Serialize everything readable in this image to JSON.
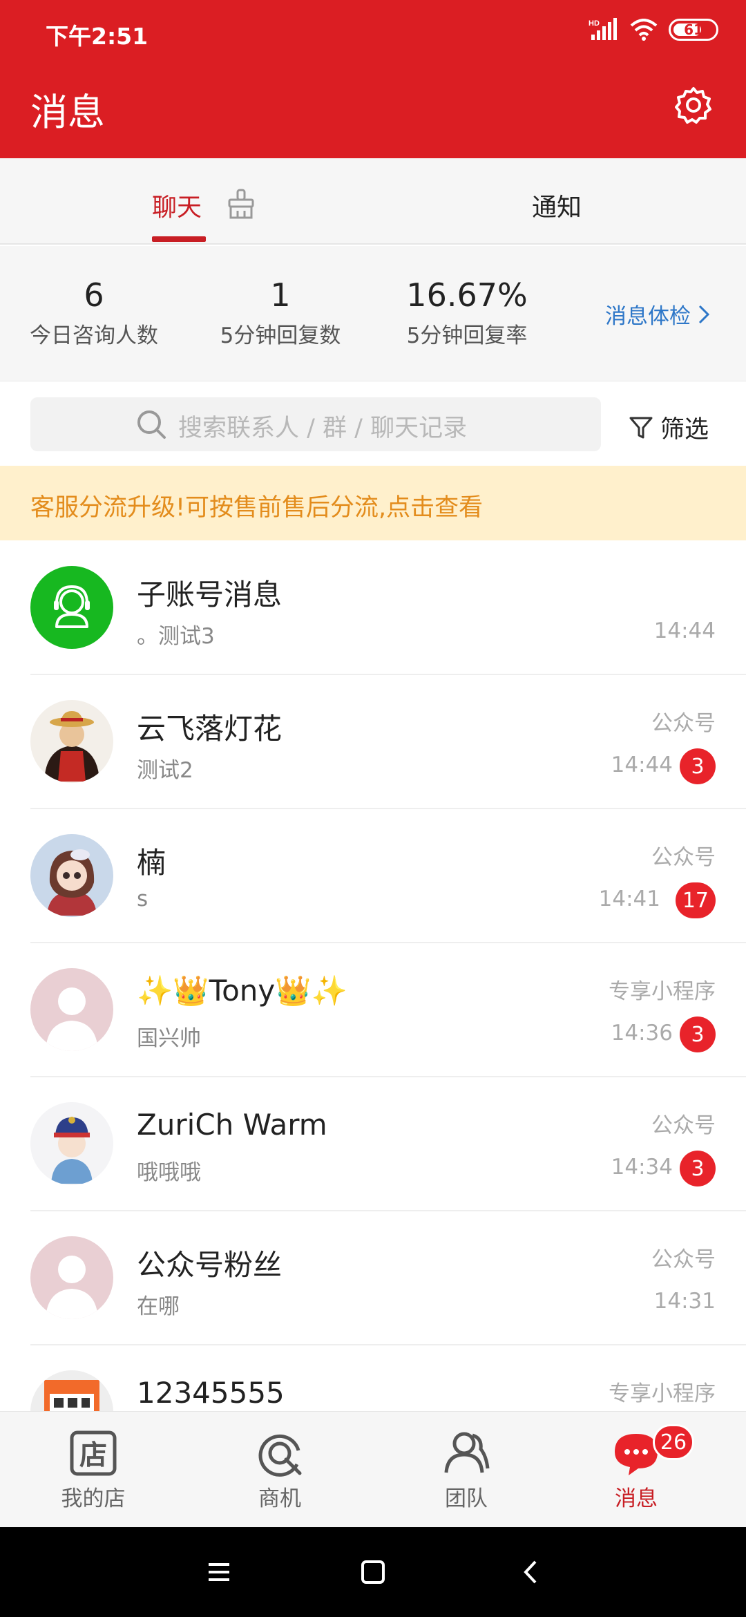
{
  "status_bar": {
    "time": "下午2:51",
    "hd": "HD",
    "battery": "61"
  },
  "header": {
    "title": "消息"
  },
  "tabs": {
    "chat": "聊天",
    "notice": "通知"
  },
  "stats": [
    {
      "value": "6",
      "label": "今日咨询人数"
    },
    {
      "value": "1",
      "label": "5分钟回复数"
    },
    {
      "value": "16.67%",
      "label": "5分钟回复率"
    }
  ],
  "checkup_link": "消息体检",
  "search": {
    "placeholder": "搜索联系人 / 群 / 聊天记录"
  },
  "filter_label": "筛选",
  "banner": "客服分流升级!可按售前售后分流,点击查看",
  "conversations": [
    {
      "name": "子账号消息",
      "preview": "。测试3",
      "tag": "",
      "time": "14:44",
      "badge": ""
    },
    {
      "name": "云飞落灯花",
      "preview": "测试2",
      "tag": "公众号",
      "time": "14:44",
      "badge": "3"
    },
    {
      "name": "楠",
      "preview": "s",
      "tag": "公众号",
      "time": "14:41",
      "badge": "17"
    },
    {
      "name": "✨👑Tony👑✨",
      "preview": "国兴帅",
      "tag": "专享小程序",
      "time": "14:36",
      "badge": "3"
    },
    {
      "name": "ZuriCh Warm",
      "preview": "哦哦哦",
      "tag": "公众号",
      "time": "14:34",
      "badge": "3"
    },
    {
      "name": "公众号粉丝",
      "preview": "在哪",
      "tag": "公众号",
      "time": "14:31",
      "badge": ""
    },
    {
      "name": "12345555",
      "preview": "",
      "tag": "专享小程序",
      "time": "",
      "badge": ""
    }
  ],
  "bottom_nav": [
    {
      "label": "我的店",
      "icon": "store-icon"
    },
    {
      "label": "商机",
      "icon": "opportunity-icon"
    },
    {
      "label": "团队",
      "icon": "team-icon"
    },
    {
      "label": "消息",
      "icon": "message-icon",
      "badge": "26"
    }
  ],
  "colors": {
    "brand_red": "#DB1E23",
    "active_red": "#C81E24",
    "link_blue": "#2E77C8",
    "banner_bg": "#FFF0CC",
    "banner_text": "#E38C1C"
  }
}
